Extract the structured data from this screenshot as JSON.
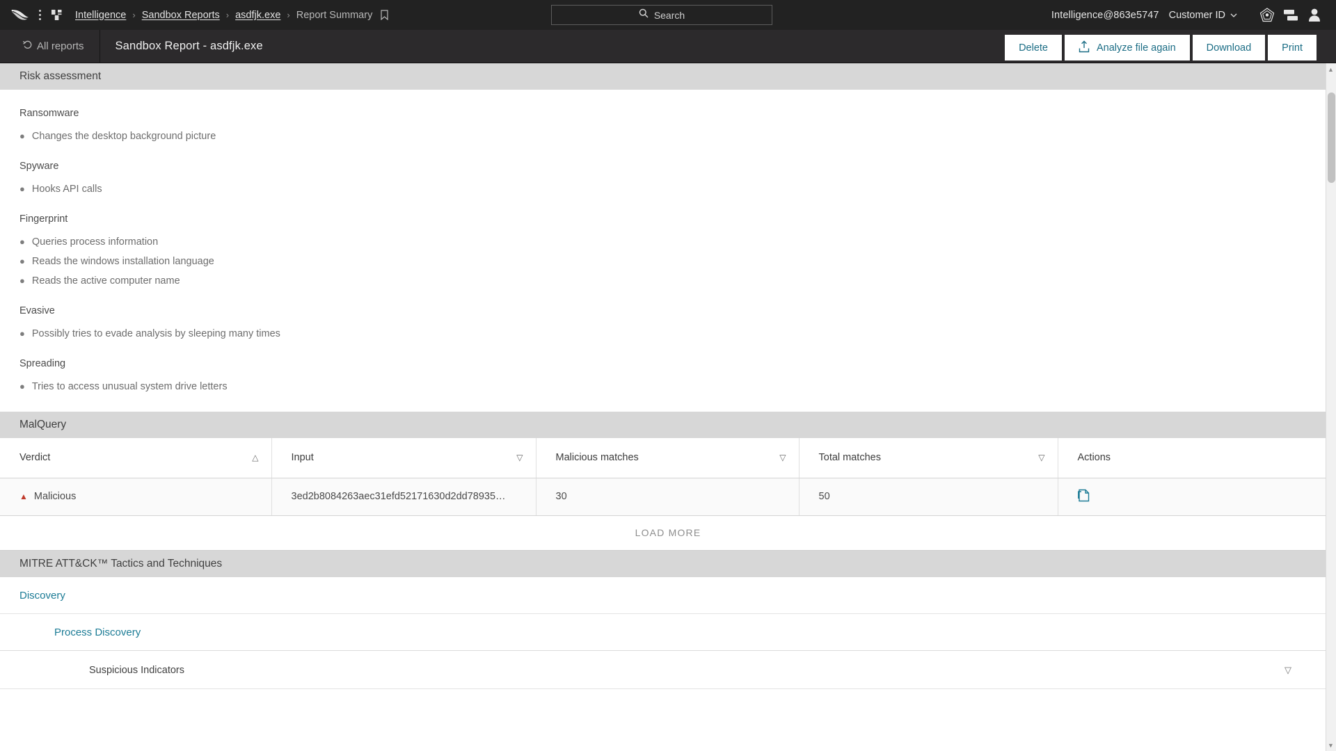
{
  "topbar": {
    "logo_icon": "falcon-logo-icon",
    "app_menu_icon": "app-grid-icon",
    "breadcrumb": [
      {
        "label": "Intelligence",
        "link": true
      },
      {
        "label": "Sandbox Reports",
        "link": true
      },
      {
        "label": "asdfjk.exe",
        "link": true
      },
      {
        "label": "Report Summary",
        "link": false
      }
    ],
    "separator": "›",
    "bookmark_icon": "bookmark-icon",
    "search": {
      "placeholder": "Search",
      "value": "",
      "icon": "search-icon"
    },
    "tenant": "Intelligence@863e5747",
    "customer_id_label": "Customer ID",
    "customer_id_caret": "⌄",
    "support_icon": "shield-badge-icon",
    "chat_icon": "chat-bubbles-icon",
    "user_icon": "user-avatar-icon"
  },
  "subbar": {
    "back_icon": "undo-arrow-icon",
    "all_reports_label": "All reports",
    "report_title": "Sandbox Report - asdfjk.exe",
    "buttons": [
      {
        "label": "Delete",
        "icon": null,
        "name": "delete-button"
      },
      {
        "label": "Analyze file again",
        "icon": "upload-icon",
        "name": "analyze-file-again-button"
      },
      {
        "label": "Download",
        "icon": null,
        "name": "download-button"
      },
      {
        "label": "Print",
        "icon": null,
        "name": "print-button"
      }
    ]
  },
  "risk_assessment": {
    "title": "Risk assessment",
    "groups": [
      {
        "category": "Ransomware",
        "items": [
          "Changes the desktop background picture"
        ]
      },
      {
        "category": "Spyware",
        "items": [
          "Hooks API calls"
        ]
      },
      {
        "category": "Fingerprint",
        "items": [
          "Queries process information",
          "Reads the windows installation language",
          "Reads the active computer name"
        ]
      },
      {
        "category": "Evasive",
        "items": [
          "Possibly tries to evade analysis by sleeping many times"
        ]
      },
      {
        "category": "Spreading",
        "items": [
          "Tries to access unusual system drive letters"
        ]
      }
    ]
  },
  "malquery": {
    "title": "MalQuery",
    "columns": [
      {
        "label": "Verdict",
        "sort_icon": "sort-ascending-icon"
      },
      {
        "label": "Input",
        "sort_icon": "sort-descending-icon"
      },
      {
        "label": "Malicious matches",
        "sort_icon": "sort-descending-icon"
      },
      {
        "label": "Total matches",
        "sort_icon": "sort-descending-icon"
      },
      {
        "label": "Actions",
        "sort_icon": null
      }
    ],
    "rows": [
      {
        "verdict": "Malicious",
        "verdict_marker": "▲",
        "verdict_color": "#c0392b",
        "input": "3ed2b8084263aec31efd52171630d2dd78935…",
        "malicious_matches": "30",
        "total_matches": "50",
        "action_icon": "copy-file-icon"
      }
    ],
    "load_more_label": "LOAD MORE"
  },
  "mitre": {
    "title": "MITRE ATT&CK™ Tactics and Techniques",
    "tactic": "Discovery",
    "technique": "Process Discovery",
    "indicator_group": "Suspicious Indicators",
    "indicator_filter_icon": "filter-icon"
  },
  "colors": {
    "topbar_bg": "#222222",
    "subbar_bg": "#2c2a2c",
    "section_header_bg": "#d7d7d7",
    "link_blue": "#1b7b95",
    "button_text": "#1b6d85",
    "malicious_red": "#c0392b"
  }
}
